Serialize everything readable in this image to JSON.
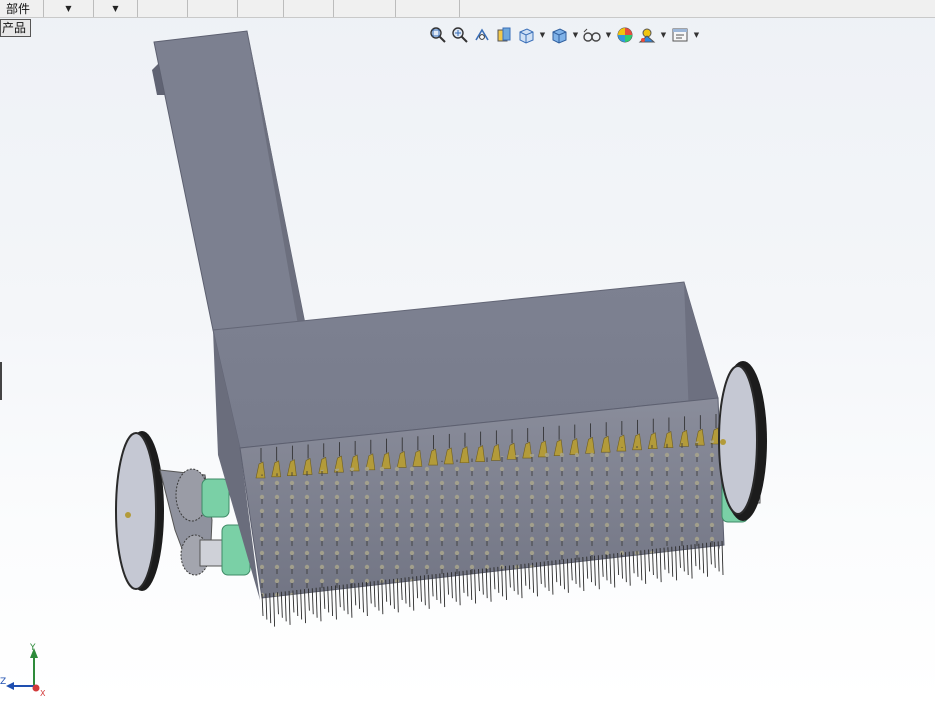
{
  "toolbar": {
    "tab_label": "部件",
    "cells": [
      "",
      "",
      "",
      "",
      "",
      ""
    ]
  },
  "panel_tag": "产品",
  "view_tools": [
    {
      "icon": "zoom-to-fit-icon"
    },
    {
      "icon": "zoom-to-area-icon"
    },
    {
      "icon": "previous-view-icon"
    },
    {
      "icon": "section-view-icon"
    },
    {
      "icon": "view-orientation-icon",
      "dropdown": true
    },
    {
      "icon": "display-style-icon",
      "dropdown": true
    },
    {
      "icon": "hide-show-items-icon",
      "dropdown": true
    },
    {
      "icon": "edit-appearance-icon"
    },
    {
      "icon": "apply-scene-icon",
      "dropdown": true
    },
    {
      "icon": "view-settings-icon",
      "dropdown": true
    }
  ],
  "colors": {
    "body": "#7b7f8f",
    "body_dark": "#6c6f7e",
    "body_light": "#8a8d9c",
    "wheel": "#1c1c1c",
    "hub": "#c5c8d3",
    "bearing": "#7ad0a6",
    "tine": "#2a2a2a",
    "gold": "#b39b3a"
  },
  "triad": {
    "y": "Y",
    "x": "X",
    "z": "Z"
  }
}
